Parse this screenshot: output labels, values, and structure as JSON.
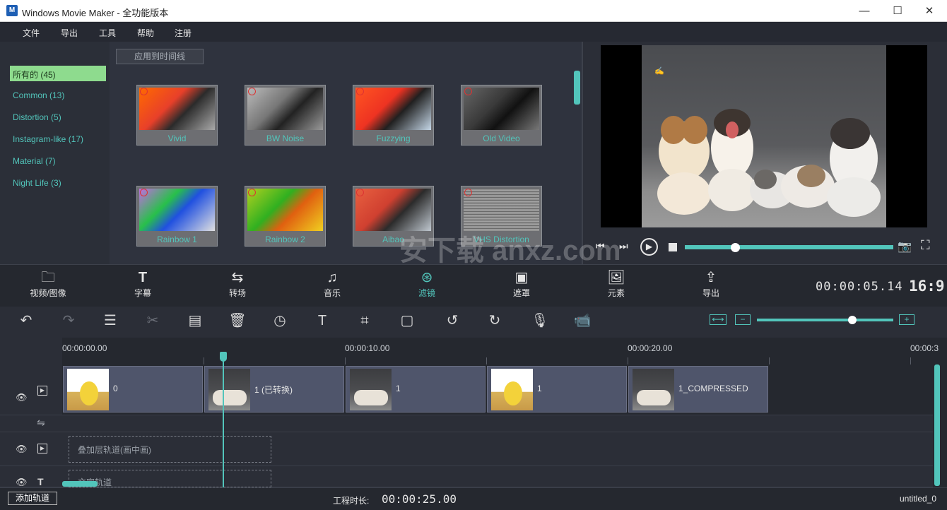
{
  "window": {
    "title": "Windows Movie Maker  - 全功能版本",
    "app_icon": "M"
  },
  "window_controls": {
    "minimize": "—",
    "maximize": "☐",
    "close": "✕"
  },
  "menu": [
    "文件",
    "导出",
    "工具",
    "帮助",
    "注册"
  ],
  "categories": [
    {
      "label": "所有的 (45)",
      "selected": true
    },
    {
      "label": "Common (13)"
    },
    {
      "label": "Distortion (5)"
    },
    {
      "label": "Instagram-like (17)"
    },
    {
      "label": "Material (7)"
    },
    {
      "label": "Night Life (3)"
    }
  ],
  "apply_button": "应用到时间线",
  "filters": [
    "Vivid",
    "BW Noise",
    "Fuzzying",
    "Old Video",
    "Rainbow 1",
    "Rainbow 2",
    "Aibao",
    "VHS Distortion"
  ],
  "preview": {
    "progress": 0.24
  },
  "tabs": [
    "视频/图像",
    "字幕",
    "转场",
    "音乐",
    "滤镜",
    "遮罩",
    "元素",
    "导出"
  ],
  "active_tab": "滤镜",
  "timecode": "00:00:05.14",
  "aspect_ratio": "16:9",
  "zoom_level": 0.7,
  "ruler": [
    "00:00:00.00",
    "00:00:10.00",
    "00:00:20.00",
    "00:00:3"
  ],
  "clips": [
    {
      "label": "0",
      "type": "cartoon"
    },
    {
      "label": "1 (已转换)",
      "type": "dogs"
    },
    {
      "label": "1",
      "type": "dogs"
    },
    {
      "label": "1",
      "type": "cartoon"
    },
    {
      "label": "1_COMPRESSED",
      "type": "dogs"
    }
  ],
  "overlay_track_placeholder": "叠加层轨道(画中画)",
  "text_track_placeholder": "文字轨道",
  "add_track_button": "添加轨道",
  "duration_label": "工程时长:",
  "duration_value": "00:00:25.00",
  "project_name": "untitled_0",
  "watermark": "安下载 anxz.com"
}
